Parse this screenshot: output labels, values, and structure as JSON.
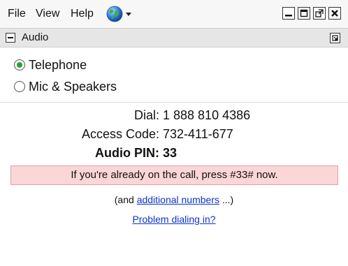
{
  "menubar": {
    "file": "File",
    "view": "View",
    "help": "Help"
  },
  "panel": {
    "title": "Audio"
  },
  "audio_options": {
    "telephone": "Telephone",
    "mic_speakers": "Mic & Speakers",
    "selected": "Telephone"
  },
  "dial_info": {
    "dial_label": "Dial:",
    "dial_value": "1 888 810 4386",
    "access_label": "Access Code:",
    "access_value": "732-411-677",
    "pin_label": "Audio PIN:",
    "pin_value": "33"
  },
  "alert": {
    "text": "If you're already on the call, press #33# now."
  },
  "more_numbers": {
    "prefix": "(and ",
    "link": "additional numbers",
    "suffix": " ...)"
  },
  "problem_link": "Problem dialing in?",
  "colors": {
    "alert_background": "#fad6d6",
    "alert_border": "#e2a0a0",
    "link": "#0b34cc",
    "radio_selected": "#2ca02c"
  },
  "icons": {
    "globe": "globe-icon",
    "dropdown": "chevron-down-icon",
    "minimize": "minimize-icon",
    "maximize": "maximize-icon",
    "restore": "restore-icon",
    "close": "close-icon",
    "collapse": "collapse-icon",
    "popout": "popout-icon"
  }
}
